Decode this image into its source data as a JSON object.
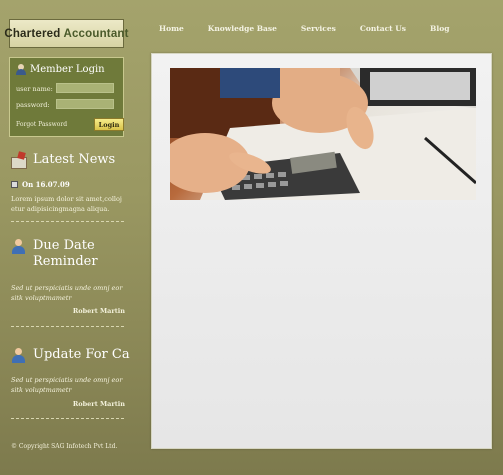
{
  "logo": {
    "word1": "Chartered",
    "word2": "Accountant"
  },
  "nav": [
    "Home",
    "Knowledge Base",
    "Services",
    "Contact Us",
    "Blog"
  ],
  "login": {
    "title": "Member Login",
    "username_label": "user name:",
    "password_label": "password:",
    "forgot": "Forgot Password",
    "button": "Login"
  },
  "news": {
    "title": "Latest News",
    "date": "On 16.07.09",
    "text": "Lorem ipsum dolor sit amet,colloj etur adipisicingmagna aliqua."
  },
  "due": {
    "title_line1": "Due Date",
    "title_line2": "Reminder",
    "text": "Sed ut perspiciatis unde omnj eor sitk voluptmametr",
    "author": "Robert Martin"
  },
  "update": {
    "title": "Update For Ca",
    "text": "Sed ut perspiciatis unde omnj eor sitk voluptmametr",
    "author": "Robert Martin"
  },
  "copyright": "© Copyright SAG Infotech Pvt Ltd.",
  "colors": {
    "background": "#9a9862",
    "login_box": "#6f7a3a",
    "content": "#eeeeee"
  },
  "hero_image": "hands-calculator-photo"
}
